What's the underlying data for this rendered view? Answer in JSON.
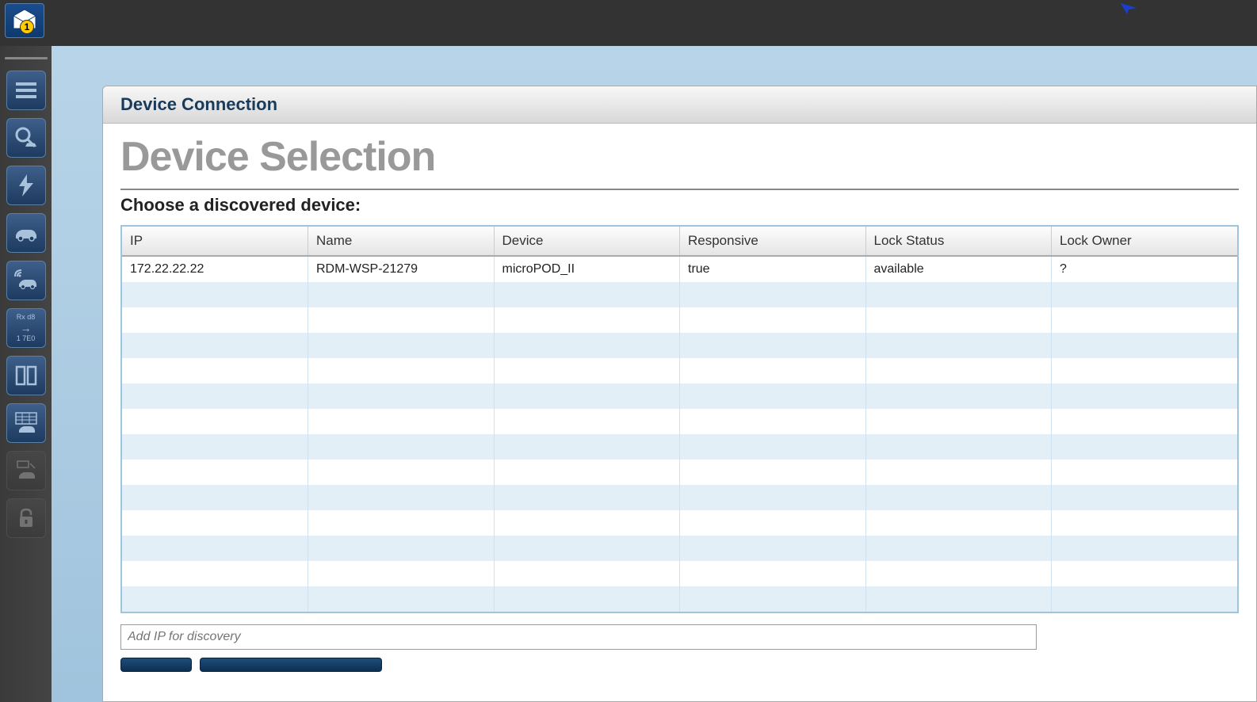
{
  "top": {
    "badge": "1"
  },
  "panel": {
    "header": "Device Connection",
    "title": "Device Selection",
    "subtitle": "Choose a discovered device:"
  },
  "table": {
    "headers": {
      "ip": "IP",
      "name": "Name",
      "device": "Device",
      "responsive": "Responsive",
      "lock_status": "Lock Status",
      "lock_owner": "Lock Owner"
    },
    "rows": [
      {
        "ip": "172.22.22.22",
        "name": "RDM-WSP-21279",
        "device": "microPOD_II",
        "responsive": "true",
        "lock_status": "available",
        "lock_owner": "?"
      }
    ]
  },
  "ip_input": {
    "placeholder": "Add IP for discovery"
  },
  "sidebar_text": {
    "line1": "Rx  d8",
    "line2": "1 7E0"
  }
}
